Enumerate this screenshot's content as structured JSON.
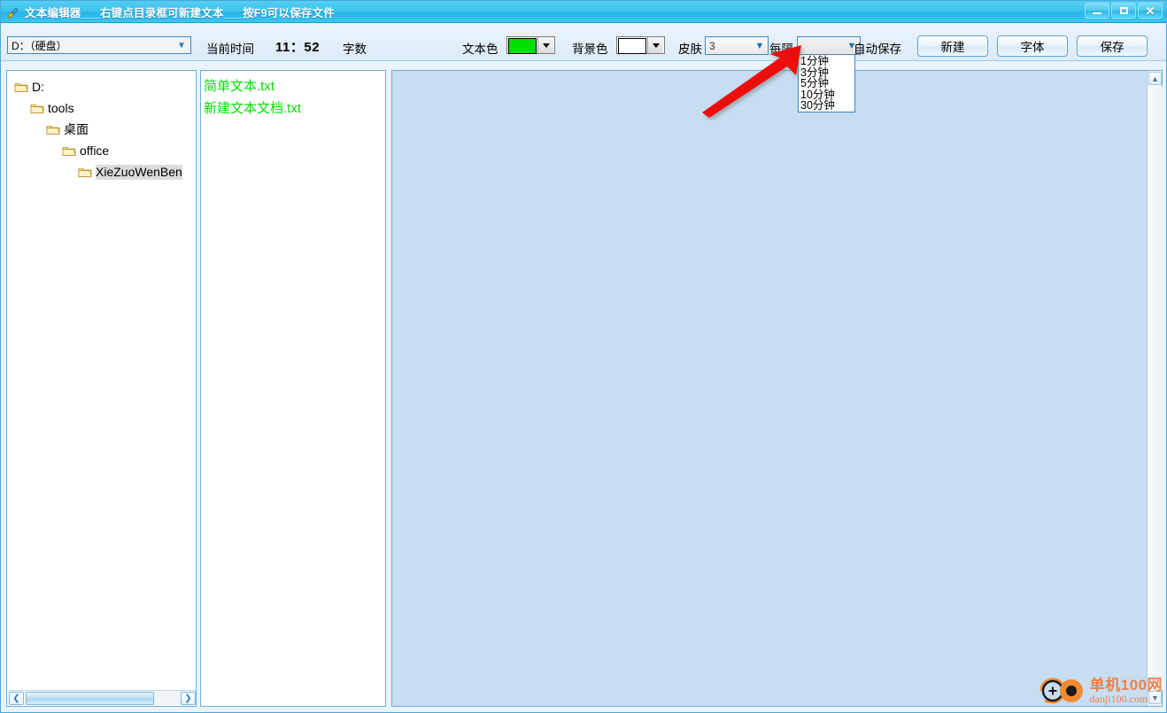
{
  "window": {
    "title": "文本编辑器___右键点目录框可新建文本___按F9可以保存文件",
    "icon": "brush-icon",
    "controls": {
      "minimize": "minimize-icon",
      "maximize": "maximize-icon",
      "close": "close-icon"
    }
  },
  "toolbar": {
    "drive": {
      "value": "D：（硬盘）",
      "icon": "chevron-down-icon"
    },
    "time": {
      "label": "当前时间",
      "value": "11：52"
    },
    "word_count_label": "字数",
    "text_color": {
      "label": "文本色",
      "value": "#00e000",
      "icon": "triangle-down-icon"
    },
    "bg_color": {
      "label": "背景色",
      "value": "#ffffff",
      "icon": "triangle-down-icon"
    },
    "skin": {
      "label": "皮肤",
      "value": "3",
      "icon": "chevron-down-icon"
    },
    "interval": {
      "label": "每隔",
      "value": "",
      "icon": "chevron-down-icon"
    },
    "autosave_label": "自动保存",
    "buttons": [
      {
        "name": "new-button",
        "label": "新建"
      },
      {
        "name": "font-button",
        "label": "字体"
      },
      {
        "name": "save-button",
        "label": "保存"
      }
    ]
  },
  "interval_dropdown": {
    "open": true,
    "options": [
      "1分钟",
      "3分钟",
      "5分钟",
      "10分钟",
      "30分钟"
    ]
  },
  "tree": {
    "nodes": [
      {
        "label": "D:",
        "depth": 0,
        "selected": false
      },
      {
        "label": "tools",
        "depth": 1,
        "selected": false
      },
      {
        "label": "桌面",
        "depth": 2,
        "selected": false
      },
      {
        "label": "office",
        "depth": 3,
        "selected": false
      },
      {
        "label": "XieZuoWenBen",
        "depth": 4,
        "selected": true
      }
    ],
    "hscroll": {
      "left_arrow": "chevron-left-icon",
      "right_arrow": "chevron-right-icon"
    }
  },
  "files": {
    "items": [
      "简单文本.txt",
      "新建文本文档.txt"
    ],
    "color": "#00e000"
  },
  "editor": {
    "content": "",
    "background": "#c6ddf2",
    "scroll": {
      "up_arrow": "chevron-up-icon",
      "down_arrow": "chevron-down-icon"
    }
  },
  "annotation": {
    "type": "red-arrow",
    "color": "#ee1111"
  },
  "watermark": {
    "line1": "单机100网",
    "line2": "danji100.com",
    "color": "#e9824b"
  }
}
